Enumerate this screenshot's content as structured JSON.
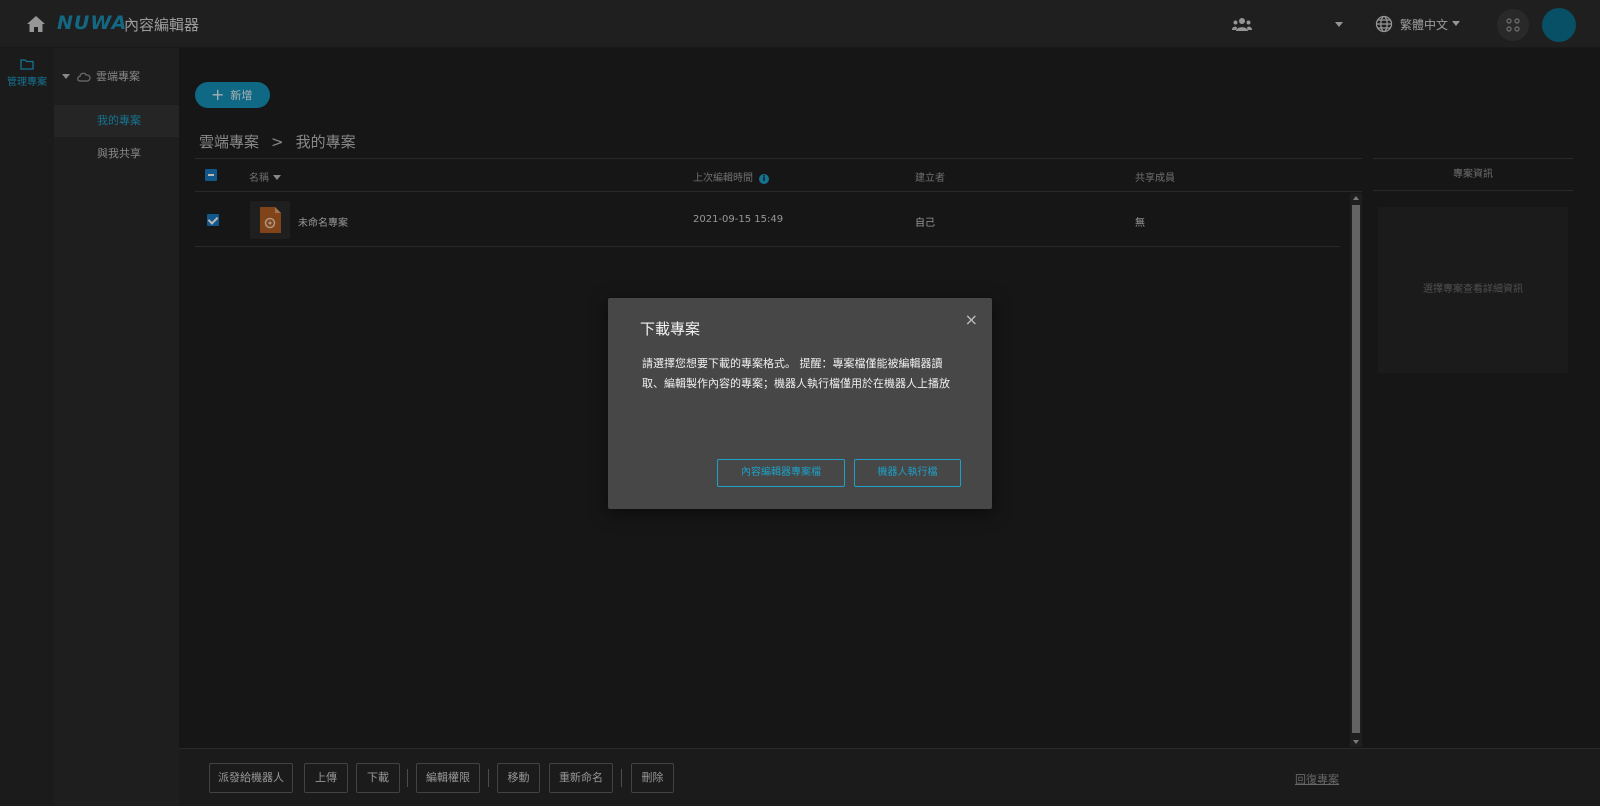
{
  "app": {
    "logo_text": "NUWA",
    "title": "內容編輯器"
  },
  "topbar": {
    "language": "繁體中文"
  },
  "rail": {
    "manage_label": "管理專案"
  },
  "tree": {
    "root_label": "雲端專案",
    "items": [
      {
        "label": "我的專案",
        "active": true
      },
      {
        "label": "與我共享",
        "active": false
      }
    ]
  },
  "main": {
    "new_button": "新增",
    "breadcrumb": {
      "root": "雲端專案",
      "separator": ">",
      "current": "我的專案"
    }
  },
  "table": {
    "columns": {
      "name": "名稱",
      "last_edited": "上次編輯時間",
      "creator": "建立者",
      "shared_members": "共享成員"
    },
    "rows": [
      {
        "name": "未命名專案",
        "last_edited": "2021-09-15 15:49",
        "creator": "自己",
        "shared_members": "無",
        "checked": true
      }
    ]
  },
  "info_panel": {
    "title": "專案資訊",
    "placeholder": "選擇專案查看詳細資訊"
  },
  "toolbar": {
    "send_to_robot": "派發給機器人",
    "upload": "上傳",
    "download": "下載",
    "edit_permission": "編輯權限",
    "move": "移動",
    "rename": "重新命名",
    "delete": "刪除",
    "restore": "回復專案"
  },
  "modal": {
    "title": "下載專案",
    "close": "×",
    "body": "請選擇您想要下載的專案格式。 提醒：專案檔僅能被編輯器讀取、編輯製作內容的專案；機器人執行檔僅用於在機器人上播放",
    "option_editor_file": "內容編輯器專案檔",
    "option_robot_file": "機器人執行檔"
  },
  "colors": {
    "accent": "#1ea0c9",
    "avatar": "#0a6f8c",
    "checkbox": "#1a79c0"
  },
  "icons": [
    "home-icon",
    "users-icon",
    "globe-icon",
    "apps-icon",
    "folder-icon",
    "cloud-icon",
    "info-icon",
    "close-icon",
    "plus-icon"
  ]
}
